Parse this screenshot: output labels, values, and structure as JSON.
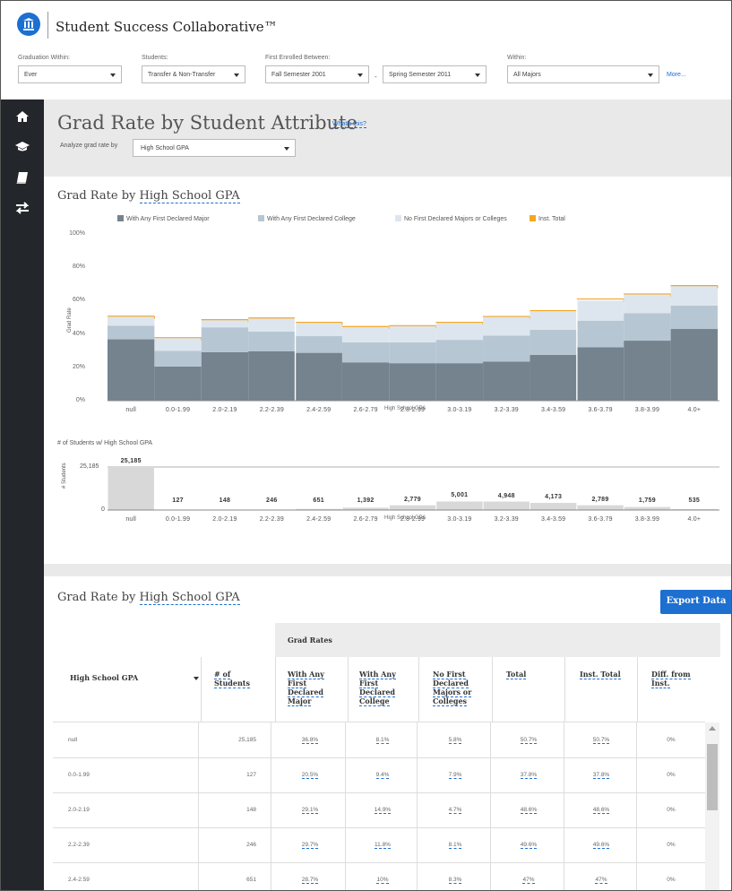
{
  "header": {
    "title": "Student Success Collaborative™"
  },
  "filters": {
    "graduation_within": {
      "label": "Graduation Within:",
      "value": "Ever"
    },
    "students": {
      "label": "Students:",
      "value": "Transfer & Non-Transfer"
    },
    "first_enrolled": {
      "label": "First Enrolled Between:",
      "from": "Fall Semester 2001",
      "dash": "-",
      "to": "Spring Semester 2011"
    },
    "within": {
      "label": "Within:",
      "value": "All Majors"
    },
    "more": "More..."
  },
  "sidenav": {
    "items": [
      "home-icon",
      "graduation-cap-icon",
      "book-icon",
      "transfer-arrows-icon"
    ]
  },
  "page": {
    "title": "Grad Rate by Student Attribute",
    "whats_this": "What's this?",
    "analyze_label": "Analyze grad rate by",
    "analyze_value": "High School GPA"
  },
  "chart_section": {
    "title_prefix": "Grad Rate by",
    "title_link": "High School GPA",
    "count_title": "# of Students w/ High School GPA",
    "count_ylabel": "# Students",
    "count_ymax_label": "25,185",
    "count_zero_label": "0",
    "xlabel": "High School GPA"
  },
  "colors": {
    "major": "#75838f",
    "college": "#b7c6d3",
    "none": "#dde6ee",
    "inst": "#f5a623",
    "count_bar": "#d8d8d8",
    "accent": "#1d6fd0"
  },
  "chart_data": [
    {
      "type": "bar",
      "title": "",
      "ylabel": "Grad Rate",
      "xlabel": "High School GPA",
      "yticks": [
        "0%",
        "20%",
        "40%",
        "60%",
        "80%",
        "100%"
      ],
      "ylim": [
        0,
        100
      ],
      "categories": [
        "null",
        "0.0-1.99",
        "2.0-2.19",
        "2.2-2.39",
        "2.4-2.59",
        "2.6-2.79",
        "2.8-2.99",
        "3.0-3.19",
        "3.2-3.39",
        "3.4-3.59",
        "3.6-3.79",
        "3.8-3.99",
        "4.0+"
      ],
      "stacked": true,
      "legend_position": "top",
      "series": [
        {
          "name": "With Any First Declared Major",
          "values": [
            36.8,
            20.5,
            29.1,
            29.7,
            28.7,
            23.0,
            22.5,
            22.5,
            23.5,
            27.5,
            32,
            36,
            43
          ]
        },
        {
          "name": "With Any First Declared College",
          "values": [
            8.1,
            9.4,
            14.9,
            11.8,
            10,
            12,
            12.5,
            14,
            15.5,
            15,
            16,
            16.5,
            14
          ]
        },
        {
          "name": "No First Declared Majors or Colleges",
          "values": [
            5.8,
            7.9,
            4.7,
            8.1,
            8.3,
            9.5,
            10,
            10.5,
            11.5,
            11.5,
            12,
            11.5,
            12
          ]
        },
        {
          "name": "Inst. Total",
          "values": [
            50.7,
            37.8,
            48.6,
            49.6,
            47,
            44.5,
            45,
            47,
            50.5,
            54,
            61,
            64,
            69
          ]
        }
      ],
      "vertical_markers_after": [
        "2.2-2.39",
        "3.4-3.59"
      ]
    },
    {
      "type": "bar",
      "title": "# of Students w/ High School GPA",
      "ylabel": "# Students",
      "categories": [
        "null",
        "0.0-1.99",
        "2.0-2.19",
        "2.2-2.39",
        "2.4-2.59",
        "2.6-2.79",
        "2.8-2.99",
        "3.0-3.19",
        "3.2-3.39",
        "3.4-3.59",
        "3.6-3.79",
        "3.8-3.99",
        "4.0+"
      ],
      "values": [
        25185,
        127,
        148,
        246,
        651,
        1392,
        2779,
        5001,
        4948,
        4173,
        2789,
        1759,
        535
      ],
      "value_labels": [
        "25,185",
        "127",
        "148",
        "246",
        "651",
        "1,392",
        "2,779",
        "5,001",
        "4,948",
        "4,173",
        "2,789",
        "1,759",
        "535"
      ],
      "ylim": [
        0,
        25185
      ]
    }
  ],
  "table": {
    "title_prefix": "Grad Rate by",
    "title_link": "High School GPA",
    "export_label": "Export Data",
    "group_header": "Grad Rates",
    "columns": {
      "gpa": "High School GPA",
      "students": [
        "# of",
        "Students"
      ],
      "major": [
        "With Any",
        "First",
        "Declared",
        "Major"
      ],
      "college": [
        "With Any",
        "First",
        "Declared",
        "College"
      ],
      "none": [
        "No First",
        "Declared",
        "Majors or",
        "Colleges"
      ],
      "total": "Total",
      "inst": "Inst. Total",
      "diff": [
        "Diff. from",
        "Inst."
      ]
    },
    "rows": [
      {
        "gpa": "null",
        "students": "25,185",
        "major": "36.8%",
        "college": "8.1%",
        "none": "5.8%",
        "total": "50.7%",
        "inst": "50.7%",
        "diff": "0%"
      },
      {
        "gpa": "0.0-1.99",
        "students": "127",
        "major": "20.5%",
        "college": "9.4%",
        "none": "7.9%",
        "total": "37.8%",
        "inst": "37.8%",
        "diff": "0%"
      },
      {
        "gpa": "2.0-2.19",
        "students": "148",
        "major": "29.1%",
        "college": "14.9%",
        "none": "4.7%",
        "total": "48.6%",
        "inst": "48.6%",
        "diff": "0%"
      },
      {
        "gpa": "2.2-2.39",
        "students": "246",
        "major": "29.7%",
        "college": "11.8%",
        "none": "8.1%",
        "total": "49.6%",
        "inst": "49.6%",
        "diff": "0%"
      },
      {
        "gpa": "2.4-2.59",
        "students": "651",
        "major": "28.7%",
        "college": "10%",
        "none": "8.3%",
        "total": "47%",
        "inst": "47%",
        "diff": "0%"
      }
    ]
  }
}
